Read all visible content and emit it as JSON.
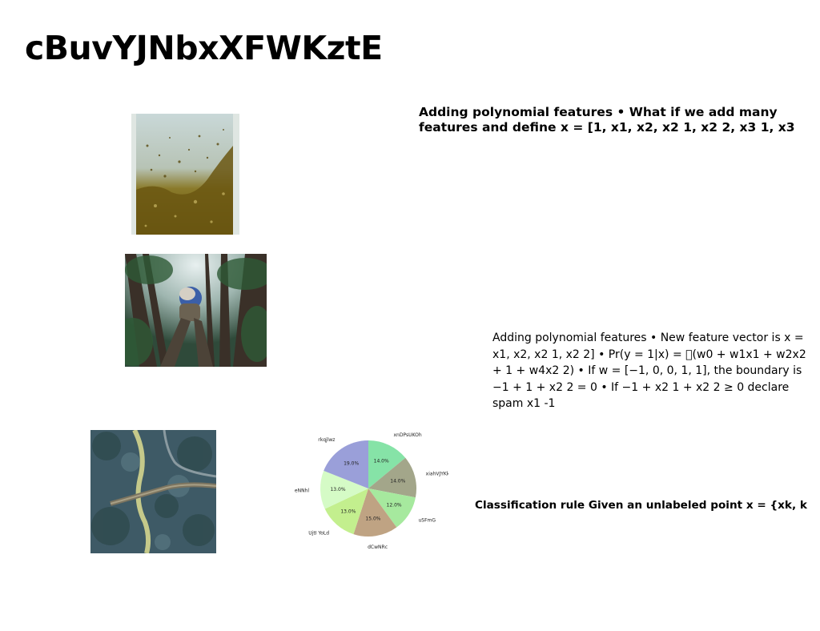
{
  "slide": {
    "title": "cBuvYJNbxXFWKztE"
  },
  "text_blocks": {
    "block1": "Adding polynomial features • What if we add many features and define x = [1, x1, x2, x2 1, x2 2, x3 1, x3",
    "block2": "Adding polynomial features • New feature vector is x = x1, x2, x2 1, x2 2] • Pr(y = 1|x) = \u0000(w0 + w1x1 + w2x2 + 1 + w4x2 2) • If w = [−1, 0, 0, 1, 1], the boundary is −1 + 1 + x2 2 = 0 • If −1 + x2 1 + x2 2 ≥ 0 declare spam x1 -1",
    "block3": "Classification rule Given an unlabeled point x = {xk, k"
  },
  "images": {
    "photo1": "glass-with-bubbles",
    "photo2": "person-in-forest",
    "photo3": "aerial-bridge"
  },
  "chart_data": {
    "type": "pie",
    "title": "",
    "start_angle_deg": 90,
    "direction": "clockwise",
    "slices": [
      {
        "label": "xnDPsUKOh",
        "value": 14.0,
        "label_text": "14.0%",
        "color": "#86e3a7"
      },
      {
        "label": "xiahVJYKk",
        "value": 14.0,
        "label_text": "14.0%",
        "color": "#a3a68a"
      },
      {
        "label": "uSFmG",
        "value": 12.0,
        "label_text": "12.0%",
        "color": "#a6e99e"
      },
      {
        "label": "dCwNRc",
        "value": 15.0,
        "label_text": "15.0%",
        "color": "#bfa383"
      },
      {
        "label": "UjtI YoLd",
        "value": 13.0,
        "label_text": "13.0%",
        "color": "#c3ef8e"
      },
      {
        "label": "eNNhl",
        "value": 13.0,
        "label_text": "13.0%",
        "color": "#d5fbc6"
      },
      {
        "label": "rkqjlwz",
        "value": 19.0,
        "label_text": "19.0%",
        "color": "#9a9fd9"
      }
    ]
  }
}
